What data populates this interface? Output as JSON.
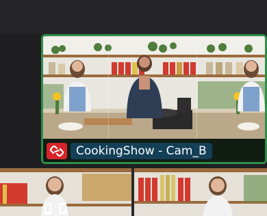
{
  "active_clip": {
    "name": "CookingShow - Cam_B",
    "link_icon": "unlink-icon"
  },
  "colors": {
    "selection_border": "#2f8f4a",
    "link_badge": "#d7262b",
    "name_badge": "#133f57"
  }
}
